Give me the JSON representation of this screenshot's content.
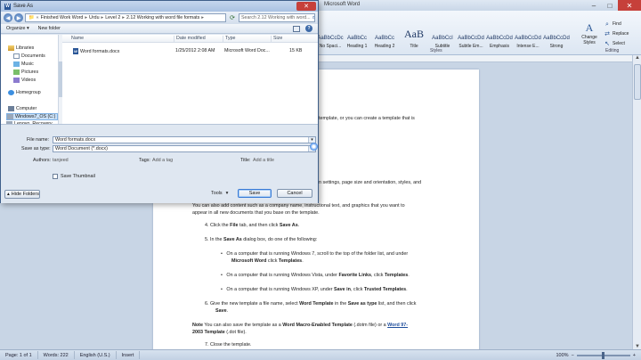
{
  "word": {
    "title": "Microsoft Word",
    "styles": [
      {
        "sample": "AaBbCcDc",
        "label": "No Spaci..."
      },
      {
        "sample": "AaBbCc",
        "label": "Heading 1"
      },
      {
        "sample": "AaBbCc",
        "label": "Heading 2"
      },
      {
        "sample": "AaB",
        "label": "Title"
      },
      {
        "sample": "AaBbCcI",
        "label": "Subtitle"
      },
      {
        "sample": "AaBbCcDd",
        "label": "Subtle Em..."
      },
      {
        "sample": "AaBbCcDd",
        "label": "Emphasis"
      },
      {
        "sample": "AaBbCcDd",
        "label": "Intense E..."
      },
      {
        "sample": "AaBbCcDd",
        "label": "Strong"
      }
    ],
    "change_styles": "Change Styles",
    "styles_group": "Styles",
    "editing_group": "Editing",
    "editing": {
      "find": "Find",
      "replace": "Replace",
      "select": "Select"
    },
    "doc": {
      "l1": "template, or you can create a template that is",
      "l2": "n settings, page size and orientation, styles, and",
      "l3": "You can also add content such as a company name, instructional text, and graphics that you want to",
      "l4": "appear in all new documents that you base on the template.",
      "s4a": "4.   Click the ",
      "s4b": "File",
      "s4c": " tab, and then click ",
      "s4d": "Save As",
      "s4e": ".",
      "s5a": "5.   In the ",
      "s5b": "Save As",
      "s5c": " dialog box, do one of the following:",
      "b1a": "On a computer that is running Windows 7, scroll to the top of the folder list, and under",
      "b1b": "Microsoft Word",
      "b1c": " click ",
      "b1d": "Templates",
      "b1e": ".",
      "b2a": "On a computer that is running Windows Vista, under ",
      "b2b": "Favorite Links",
      "b2c": ", click ",
      "b2d": "Templates",
      "b2e": ".",
      "b3a": "On a computer that is running Windows XP, under ",
      "b3b": "Save in",
      "b3c": ", click ",
      "b3d": "Trusted Templates",
      "b3e": ".",
      "s6a": "6.   Give the new template a file name, select ",
      "s6b": "Word Template",
      "s6c": " in the ",
      "s6d": "Save as type",
      "s6e": " list, and then click",
      "s6f": "Save",
      "s6g": ".",
      "noteA": "Note",
      "noteB": "  You can also save the template as a ",
      "noteC": "Word Macro-Enabled Template",
      "noteD": " (.dotm file) or a ",
      "noteE": "Word 97-",
      "noteF": "2003 Template",
      "noteG": " (.dot file).",
      "s7": "7.   Close the template."
    },
    "status": {
      "page": "Page: 1 of 1",
      "words": "Words: 222",
      "lang": "English (U.S.)",
      "mode": "Insert",
      "zoom": "100%"
    }
  },
  "dialog": {
    "title": "Save As",
    "path": [
      "Finished Work Word",
      "Urdu",
      "Level 2",
      "2.12 Working with word file formats"
    ],
    "search_placeholder": "Search 2.12 Working with word...",
    "organize": "Organize ▾",
    "new_folder": "New folder",
    "nav": [
      "Libraries",
      "Documents",
      "Music",
      "Pictures",
      "Videos",
      "Homegroup",
      "Computer",
      "Windows7_OS (C:)",
      "Lenovo_Recovery"
    ],
    "columns": {
      "name": "Name",
      "date": "Date modified",
      "type": "Type",
      "size": "Size"
    },
    "files": [
      {
        "name": "Word formats.docx",
        "date": "1/25/2012 2:08 AM",
        "type": "Microsoft Word Doc...",
        "size": "15 KB"
      }
    ],
    "file_name_label": "File name:",
    "file_name": "Word formats.docx",
    "type_label": "Save as type:",
    "type_value": "Word Document (*.docx)",
    "authors_label": "Authors:",
    "authors": "tanjeed",
    "tags_label": "Tags:",
    "tags": "Add a tag",
    "title_label": "Title:",
    "title_value": "Add a title",
    "thumbnail": "Save Thumbnail",
    "hide_folders": "Hide Folders",
    "tools": "Tools",
    "save": "Save",
    "cancel": "Cancel"
  }
}
